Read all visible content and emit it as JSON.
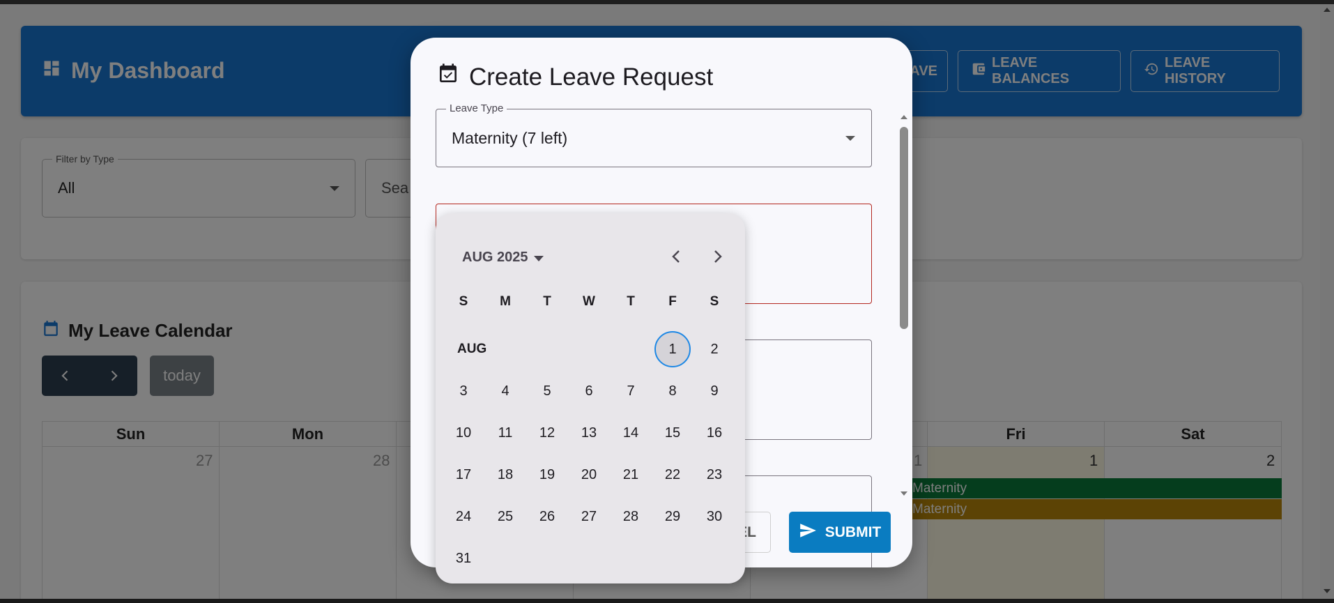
{
  "header": {
    "title": "My Dashboard",
    "buttons": [
      "AVE",
      "LEAVE BALANCES",
      "LEAVE HISTORY"
    ]
  },
  "filters": {
    "type_label": "Filter by Type",
    "type_value": "All",
    "search_placeholder": "Sea"
  },
  "calendar": {
    "title": "My Leave Calendar",
    "today_label": "today",
    "days": [
      "Sun",
      "Mon",
      "Fri",
      "Sat"
    ],
    "dates": [
      "27",
      "28",
      "1",
      "1",
      "2"
    ],
    "events": [
      "Maternity",
      "Maternity"
    ],
    "event_colors": [
      "#0b7a3b",
      "#b8860b"
    ]
  },
  "dialog": {
    "title": "Create Leave Request",
    "leave_type_label": "Leave Type",
    "leave_type_value": "Maternity (7 left)",
    "cancel_label": "EL",
    "submit_label": "SUBMIT"
  },
  "picker": {
    "month_label": "AUG 2025",
    "dow": [
      "S",
      "M",
      "T",
      "W",
      "T",
      "F",
      "S"
    ],
    "month_row_label": "AUG",
    "days": [
      "1",
      "2",
      "3",
      "4",
      "5",
      "6",
      "7",
      "8",
      "9",
      "10",
      "11",
      "12",
      "13",
      "14",
      "15",
      "16",
      "17",
      "18",
      "19",
      "20",
      "21",
      "22",
      "23",
      "24",
      "25",
      "26",
      "27",
      "28",
      "29",
      "30",
      "31"
    ],
    "selected_day": "1"
  },
  "colors": {
    "primary": "#1976d2",
    "submit": "#0a7cc1",
    "error_border": "#b3261e"
  }
}
